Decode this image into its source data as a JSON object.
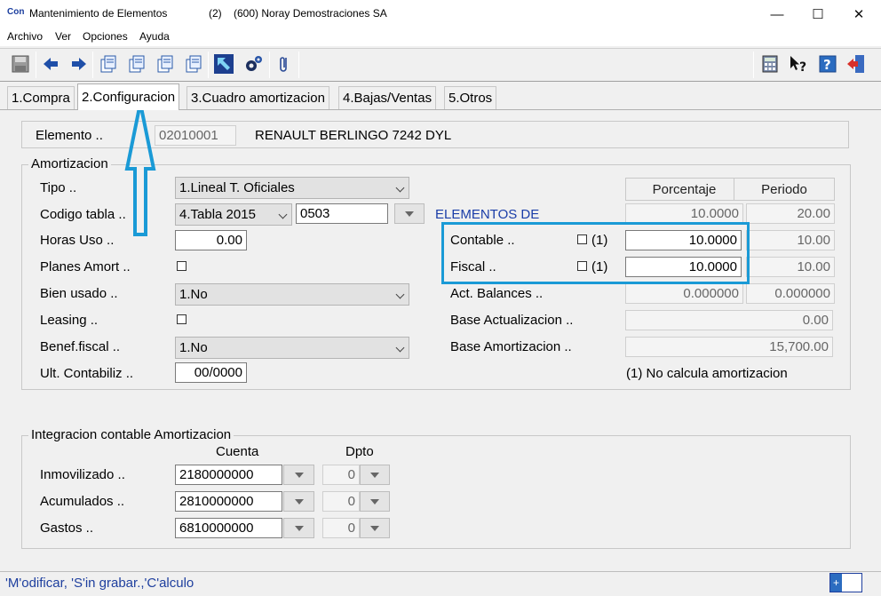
{
  "window": {
    "icon_text": "Con",
    "title": "Mantenimiento de Elementos",
    "count": "(2)",
    "company": "(600) Noray Demostraciones SA",
    "minimize": "—",
    "maximize": "☐",
    "close": "✕"
  },
  "menu": [
    {
      "label": "Archivo"
    },
    {
      "label": "Ver"
    },
    {
      "label": "Opciones"
    },
    {
      "label": "Ayuda"
    }
  ],
  "toolbar": {
    "icons": [
      "save-icon",
      "back-arrow-icon",
      "forward-arrow-icon",
      "copy-icon",
      "copy-icon",
      "copy-icon",
      "copy-icon",
      "expand-icon",
      "settings-icon",
      "attach-icon",
      "calculator-icon",
      "help-context-icon",
      "help-icon",
      "exit-icon"
    ]
  },
  "tabs": [
    {
      "label": "1.Compra"
    },
    {
      "label": "2.Configuracion",
      "active": true
    },
    {
      "label": "3.Cuadro amortizacion"
    },
    {
      "label": "4.Bajas/Ventas"
    },
    {
      "label": "5.Otros"
    }
  ],
  "elemento": {
    "label": "Elemento ..",
    "code": "02010001",
    "name": "RENAULT BERLINGO 7242 DYL"
  },
  "amortizacion": {
    "title": "Amortizacion",
    "tipo": {
      "label": "Tipo ..",
      "value": "1.Lineal T. Oficiales"
    },
    "codigo_tabla": {
      "label": "Codigo tabla ..",
      "value": "4.Tabla 2015",
      "code": "0503"
    },
    "elementos_de": "ELEMENTOS DE",
    "horas_uso": {
      "label": "Horas Uso ..",
      "value": "0.00"
    },
    "planes_amort": {
      "label": "Planes Amort .."
    },
    "bien_usado": {
      "label": "Bien usado ..",
      "value": "1.No"
    },
    "leasing": {
      "label": "Leasing .."
    },
    "benef_fiscal": {
      "label": "Benef.fiscal ..",
      "value": "1.No"
    },
    "ult_contabiliz": {
      "label": "Ult. Contabiliz ..",
      "value": "00/0000"
    },
    "headers": {
      "porcentaje": "Porcentaje",
      "periodo": "Periodo"
    },
    "top_row": {
      "porcentaje": "10.0000",
      "periodo": "20.00"
    },
    "contable": {
      "label": "Contable ..",
      "flag": "(1)",
      "porcentaje": "10.0000",
      "periodo": "10.00"
    },
    "fiscal": {
      "label": "Fiscal ..",
      "flag": "(1)",
      "porcentaje": "10.0000",
      "periodo": "10.00"
    },
    "act_balances": {
      "label": "Act. Balances ..",
      "porcentaje": "0.000000",
      "periodo": "0.000000"
    },
    "base_actualizacion": {
      "label": "Base Actualizacion ..",
      "value": "0.00"
    },
    "base_amortizacion": {
      "label": "Base Amortizacion ..",
      "value": "15,700.00"
    },
    "note": "(1) No calcula amortizacion"
  },
  "integracion": {
    "title": "Integracion contable Amortizacion",
    "col_cuenta": "Cuenta",
    "col_dpto": "Dpto",
    "rows": [
      {
        "label": "Inmovilizado ..",
        "cuenta": "2180000000",
        "dpto": "0"
      },
      {
        "label": "Acumulados ..",
        "cuenta": "2810000000",
        "dpto": "0"
      },
      {
        "label": "Gastos ..",
        "cuenta": "6810000000",
        "dpto": "0"
      }
    ]
  },
  "status": {
    "text": "'M'odificar, 'S'in grabar.,'C'alculo",
    "indicator": "+"
  },
  "colors": {
    "annotation": "#1a9ad6",
    "status_text": "#1e3f9e",
    "section_label": "#1a3da8"
  }
}
